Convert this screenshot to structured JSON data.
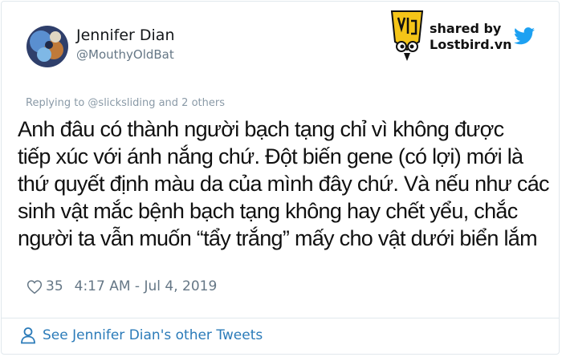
{
  "author": {
    "display_name": "Jennifer Dian",
    "handle": "@MouthyOldBat",
    "avatar_icon": "avatar-image"
  },
  "watermark": {
    "line1": "shared by",
    "line2": "Lostbird.vn",
    "logo_icon": "lostbird-logo-icon",
    "social_icon": "twitter-bird-icon",
    "twitter_blue": "#1da1f2",
    "logo_yellow": "#f5c518"
  },
  "tweet": {
    "replying_to": "Replying to @slicksliding and 2 others",
    "text": "Anh đâu có thành người bạch tạng chỉ vì không được\ntiếp xúc với ánh nắng chứ. Đột biến gene (có lợi) mới là\nthứ quyết định màu da của mình đây chứ. Và nếu như các\nsinh vật mắc bệnh bạch tạng không hay chết yểu, chắc\nngười ta vẫn muốn “tẩy trắng” mấy cho vật dưới biển lắm",
    "like_count": "35",
    "timestamp": "4:17 AM - Jul 4, 2019",
    "heart_icon": "heart-icon"
  },
  "footer": {
    "see_more": "See Jennifer Dian's other Tweets",
    "user_icon": "user-icon",
    "link_color": "#2b7bb9"
  }
}
